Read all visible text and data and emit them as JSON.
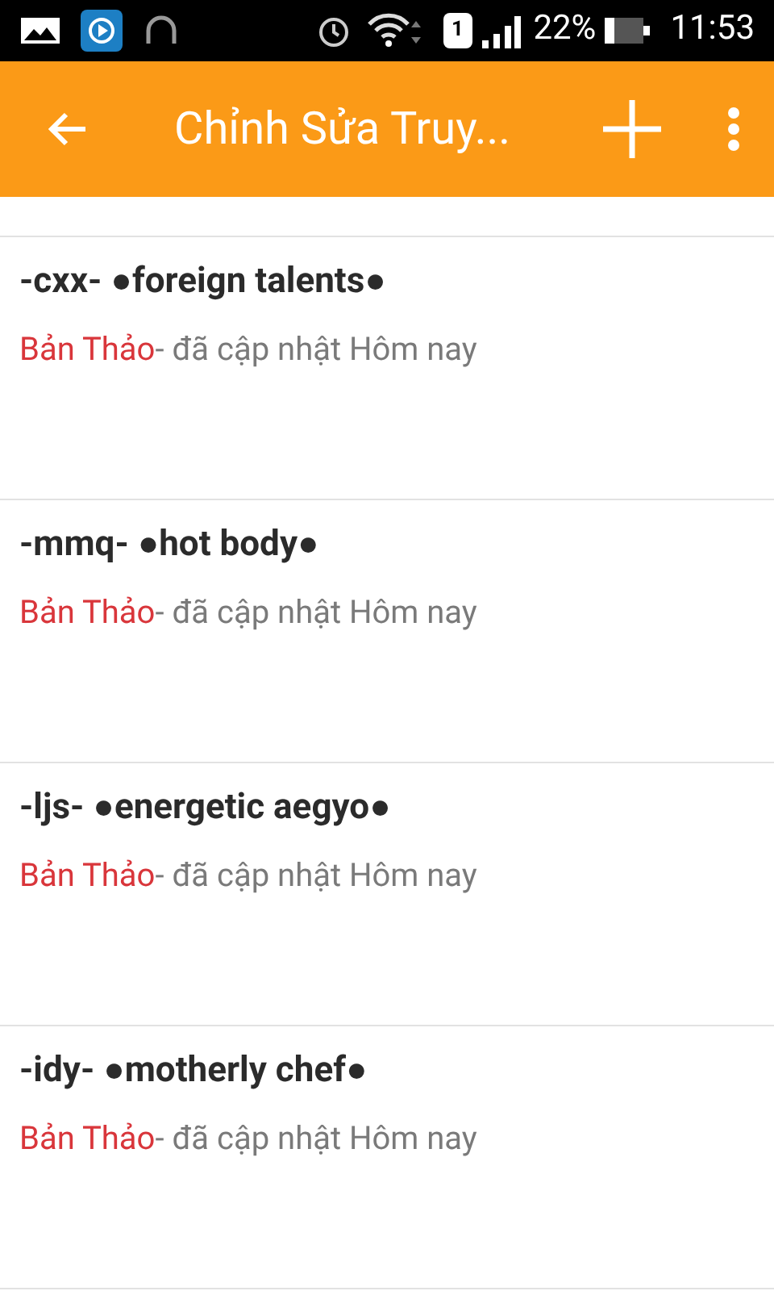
{
  "status_bar": {
    "sim": "1",
    "battery": "22%",
    "time": "11:53"
  },
  "app_bar": {
    "title": "Chỉnh Sửa Truy..."
  },
  "stories": [
    {
      "title": "-cxx- ●foreign talents●",
      "status": "Bản Thảo",
      "updated": "- đã cập nhật Hôm nay"
    },
    {
      "title": "-mmq- ●hot body●",
      "status": "Bản Thảo",
      "updated": "- đã cập nhật Hôm nay"
    },
    {
      "title": "-ljs- ●energetic aegyo●",
      "status": "Bản Thảo",
      "updated": "- đã cập nhật Hôm nay"
    },
    {
      "title": "-idy- ●motherly chef●",
      "status": "Bản Thảo",
      "updated": "- đã cập nhật Hôm nay"
    }
  ]
}
